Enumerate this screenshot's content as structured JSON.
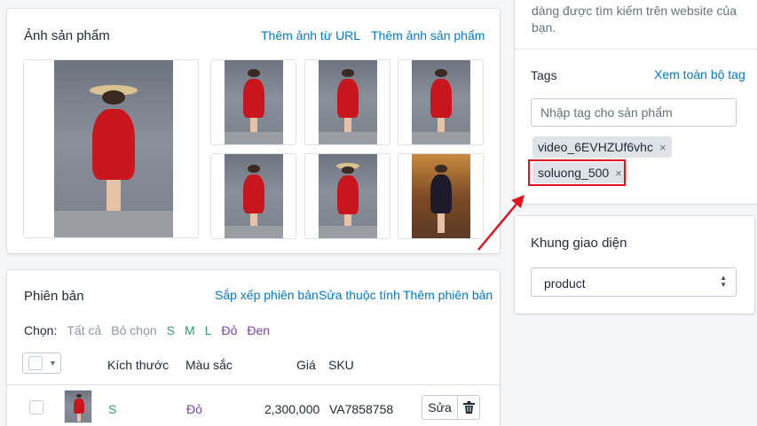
{
  "images": {
    "title": "Ảnh sản phẩm",
    "add_from_url": "Thêm ảnh từ URL",
    "add_image": "Thêm ảnh sản phẩm"
  },
  "variants": {
    "title": "Phiên bản",
    "sort": "Sắp xếp phiên bản",
    "edit_attributes": "Sửa thuộc tính",
    "add_variant": "Thêm phiên bản",
    "choose_label": "Chọn:",
    "filters": [
      "Tất cả",
      "Bỏ chọn",
      "S",
      "M",
      "L",
      "Đỏ",
      "Đen"
    ],
    "columns": [
      "Kích thước",
      "Màu sắc",
      "Giá",
      "SKU"
    ],
    "rows": [
      {
        "size": "S",
        "color": "Đỏ",
        "price": "2,300,000",
        "sku": "VA7858758",
        "edit_label": "Sửa"
      }
    ]
  },
  "seo": {
    "text_line1": "dàng được tìm kiếm trên website của",
    "text_line2": "bạn."
  },
  "tags": {
    "label": "Tags",
    "view_all": "Xem toàn bộ tag",
    "input_placeholder": "Nhập tag cho sản phẩm",
    "items": [
      "video_6EVHZUf6vhc",
      "soluong_500"
    ],
    "remove_glyph": "×"
  },
  "layout": {
    "title": "Khung giao diện",
    "selected": "product"
  },
  "colors": {
    "link": "#007ace",
    "highlight": "#e0141e",
    "tag_bg": "#dfe3e8"
  }
}
